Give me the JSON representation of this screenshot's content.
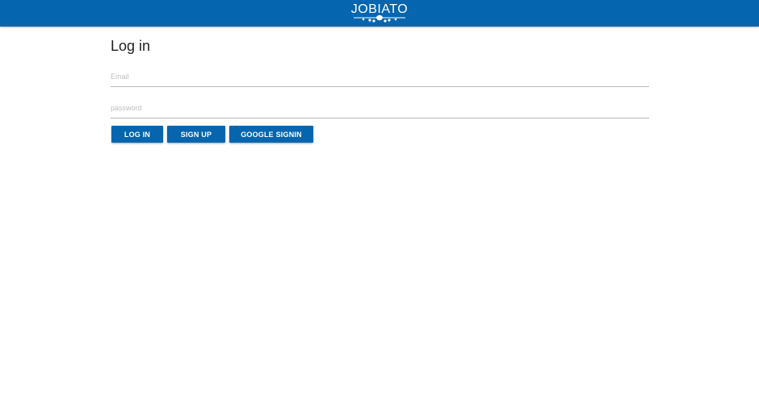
{
  "header": {
    "logo_text": "JOBIATO",
    "brand_color": "#0565ae"
  },
  "page": {
    "title": "Log in"
  },
  "form": {
    "email": {
      "value": "",
      "placeholder": "Email"
    },
    "password": {
      "value": "",
      "placeholder": "password"
    }
  },
  "buttons": {
    "login_label": "LOG IN",
    "signup_label": "SIGN UP",
    "google_label": "GOOGLE SIGNIN"
  },
  "icons": {
    "logo_plane": "airplane-icon"
  }
}
